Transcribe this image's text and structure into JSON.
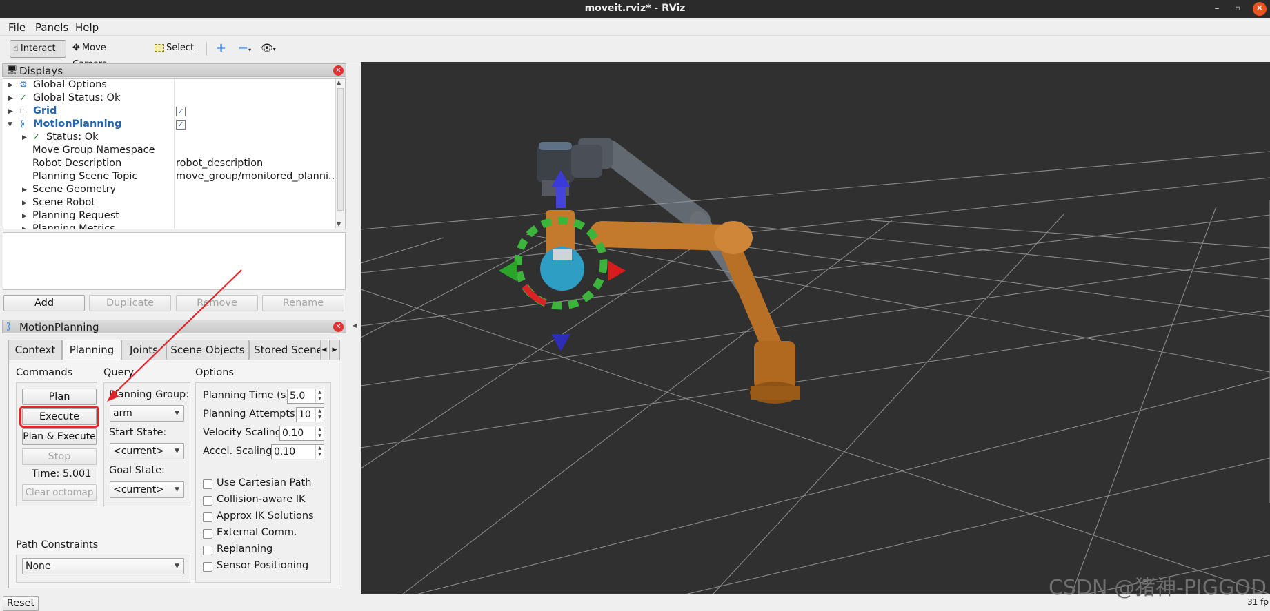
{
  "window": {
    "title": "moveit.rviz* - RViz"
  },
  "menu": {
    "file": "File",
    "panels": "Panels",
    "help": "Help"
  },
  "toolbar": {
    "interact": "Interact",
    "move_camera": "Move Camera",
    "select": "Select"
  },
  "displays": {
    "title": "Displays",
    "rows": [
      {
        "label": "Global Options",
        "value": ""
      },
      {
        "label": "Global Status: Ok",
        "value": ""
      },
      {
        "label": "Grid",
        "value": ""
      },
      {
        "label": "MotionPlanning",
        "value": ""
      },
      {
        "label": "Status: Ok",
        "value": ""
      },
      {
        "label": "Move Group Namespace",
        "value": ""
      },
      {
        "label": "Robot Description",
        "value": "robot_description"
      },
      {
        "label": "Planning Scene Topic",
        "value": "move_group/monitored_planni..."
      },
      {
        "label": "Scene Geometry",
        "value": ""
      },
      {
        "label": "Scene Robot",
        "value": ""
      },
      {
        "label": "Planning Request",
        "value": ""
      },
      {
        "label": "Planning Metrics",
        "value": ""
      }
    ],
    "buttons": {
      "add": "Add",
      "duplicate": "Duplicate",
      "remove": "Remove",
      "rename": "Rename"
    }
  },
  "motion_planning": {
    "title": "MotionPlanning",
    "tabs": [
      "Context",
      "Planning",
      "Joints",
      "Scene Objects",
      "Stored Scene"
    ],
    "commands": {
      "label": "Commands",
      "plan": "Plan",
      "execute": "Execute",
      "plan_execute": "Plan & Execute",
      "stop": "Stop",
      "time": "Time: 5.001",
      "clear_octomap": "Clear octomap"
    },
    "query": {
      "label": "Query",
      "planning_group_label": "Planning Group:",
      "planning_group": "arm",
      "start_state_label": "Start State:",
      "start_state": "<current>",
      "goal_state_label": "Goal State:",
      "goal_state": "<current>"
    },
    "options": {
      "label": "Options",
      "planning_time_label": "Planning Time (s):",
      "planning_time": "5.0",
      "planning_attempts_label": "Planning Attempts:",
      "planning_attempts": "10",
      "velocity_scaling_label": "Velocity Scaling:",
      "velocity_scaling": "0.10",
      "accel_scaling_label": "Accel. Scaling:",
      "accel_scaling": "0.10",
      "checkboxes": [
        "Use Cartesian Path",
        "Collision-aware IK",
        "Approx IK Solutions",
        "External Comm.",
        "Replanning",
        "Sensor Positioning"
      ]
    },
    "path_constraints": {
      "label": "Path Constraints",
      "value": "None"
    }
  },
  "status": {
    "reset": "Reset",
    "fps": "31 fp"
  },
  "watermark": "CSDN @猪神-PIGGOD",
  "colors": {
    "highlight": "#e0262b",
    "link": "#2466b3",
    "robot": "#c47a2c",
    "viewport_bg": "#303030"
  }
}
